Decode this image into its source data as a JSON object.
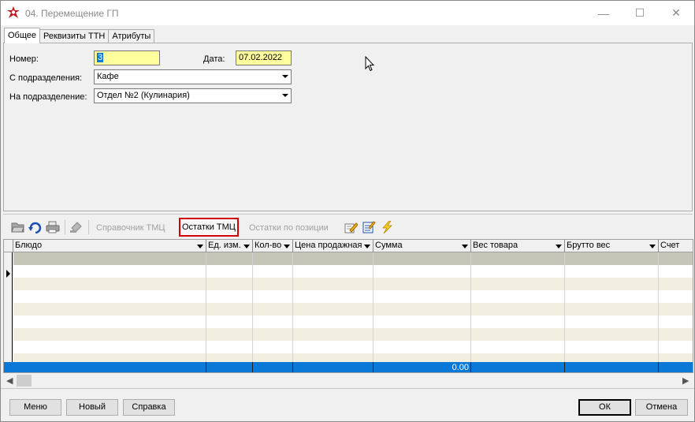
{
  "window": {
    "title": "04. Перемещение ГП",
    "minimize": "—",
    "maximize": "☐",
    "close": "✕"
  },
  "tabs": [
    {
      "label": "Общее",
      "active": true
    },
    {
      "label": "Реквизиты ТТН",
      "active": false
    },
    {
      "label": "Атрибуты",
      "active": false
    }
  ],
  "form": {
    "number_label": "Номер:",
    "number_value": "3",
    "date_label": "Дата:",
    "date_value": "07.02.2022",
    "from_label": "С подразделения:",
    "from_value": "Кафе",
    "to_label": "На подразделение:",
    "to_value": "Отдел №2 (Кулинария)"
  },
  "toolbar": {
    "icons": [
      "open-folder-icon",
      "refresh-icon",
      "print-icon",
      "stamp-icon"
    ],
    "catalog_label": "Справочник ТМЦ",
    "stock_label": "Остатки ТМЦ",
    "stock_by_position_label": "Остатки по позиции",
    "icons_right": [
      "edit-pencil-icon",
      "checklist-icon",
      "lightning-icon"
    ]
  },
  "grid": {
    "columns": [
      "Блюдо",
      "Ед. изм.",
      "Кол-во",
      "Цена продажная",
      "Сумма",
      "Вес товара",
      "Брутто вес",
      "Счет"
    ],
    "footer_sum": "0.00"
  },
  "buttons": {
    "menu": "Меню",
    "new": "Новый",
    "help": "Справка",
    "ok": "ОК",
    "cancel": "Отмена"
  },
  "colors": {
    "accent_blue": "#0078d7",
    "field_yellow": "#ffff9d",
    "row_alt": "#f1f0e0",
    "selected_row": "#c6c6b8",
    "highlight_red": "#d00000"
  }
}
